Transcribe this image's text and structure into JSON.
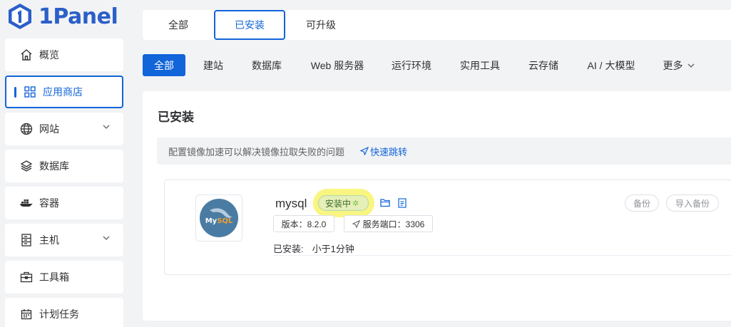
{
  "brand": {
    "name": "1Panel",
    "color": "#2b5fc8"
  },
  "sidebar": {
    "items": [
      {
        "label": "概览",
        "icon": "home-icon"
      },
      {
        "label": "应用商店",
        "icon": "grid-icon",
        "active": true
      },
      {
        "label": "网站",
        "icon": "globe-icon",
        "expandable": true
      },
      {
        "label": "数据库",
        "icon": "layers-icon"
      },
      {
        "label": "容器",
        "icon": "docker-icon"
      },
      {
        "label": "主机",
        "icon": "server-icon",
        "expandable": true
      },
      {
        "label": "工具箱",
        "icon": "toolbox-icon"
      },
      {
        "label": "计划任务",
        "icon": "calendar-icon"
      }
    ]
  },
  "tabs": [
    {
      "label": "全部"
    },
    {
      "label": "已安装",
      "active": true
    },
    {
      "label": "可升级"
    }
  ],
  "categories": [
    {
      "label": "全部",
      "active": true
    },
    {
      "label": "建站"
    },
    {
      "label": "数据库"
    },
    {
      "label": "Web 服务器"
    },
    {
      "label": "运行环境"
    },
    {
      "label": "实用工具"
    },
    {
      "label": "云存储"
    },
    {
      "label": "AI / 大模型"
    },
    {
      "label": "更多"
    }
  ],
  "main": {
    "title": "已安装",
    "notice": "配置镜像加速可以解决镜像拉取失败的问题",
    "notice_link": "快速跳转",
    "app": {
      "name": "mysql",
      "logo_text": "MySQL",
      "status": "安装中",
      "version": "版本：8.2.0",
      "port": "服务端口：3306",
      "installed_label": "已安装:",
      "installed_value": "小于1分钟",
      "backup_label": "备份",
      "import_backup_label": "导入备份"
    }
  },
  "colors": {
    "accent": "#1264d9",
    "highlight": "#f8f36b"
  }
}
